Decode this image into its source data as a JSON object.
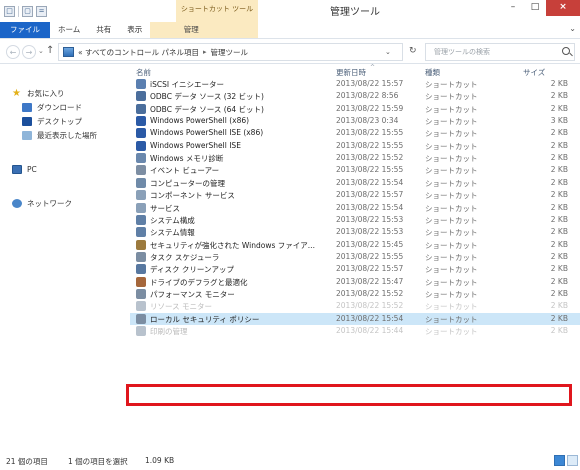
{
  "window": {
    "title": "管理ツール",
    "contextual_group": "ショートカット ツール"
  },
  "quick_access": [
    "□",
    "▢",
    "="
  ],
  "ribbon": {
    "tabs": [
      {
        "label": "ファイル",
        "kind": "file"
      },
      {
        "label": "ホーム",
        "kind": "normal"
      },
      {
        "label": "共有",
        "kind": "normal"
      },
      {
        "label": "表示",
        "kind": "normal"
      },
      {
        "label": "管理",
        "kind": "ctx"
      }
    ],
    "expand_glyph": "⌄"
  },
  "window_controls": {
    "minimize": "–",
    "maximize": "□",
    "close": "×"
  },
  "address_bar": {
    "back": "←",
    "forward": "→",
    "dropdown": "⌄",
    "up": "↑",
    "crumbs": [
      "« すべてのコントロール パネル項目",
      "管理ツール"
    ],
    "crumb_separator": "▸",
    "refresh": "↻",
    "search_placeholder": "管理ツールの検索"
  },
  "navigation": {
    "favorites": "お気に入り",
    "items": [
      "ダウンロード",
      "デスクトップ",
      "最近表示した場所"
    ],
    "pc": "PC",
    "network": "ネットワーク"
  },
  "columns": {
    "name": "名前",
    "date": "更新日時",
    "type": "種類",
    "size": "サイズ"
  },
  "files": [
    {
      "name": "iSCSI イニシエーター",
      "date": "2013/08/22 15:57",
      "type": "ショートカット",
      "size": "2 KB",
      "icon_color": "#5a7fb0"
    },
    {
      "name": "ODBC データ ソース (32 ビット)",
      "date": "2013/08/22 8:56",
      "type": "ショートカット",
      "size": "2 KB",
      "icon_color": "#4b6e9c"
    },
    {
      "name": "ODBC データ ソース (64 ビット)",
      "date": "2013/08/22 15:59",
      "type": "ショートカット",
      "size": "2 KB",
      "icon_color": "#4b6e9c"
    },
    {
      "name": "Windows PowerShell (x86)",
      "date": "2013/08/23 0:34",
      "type": "ショートカット",
      "size": "3 KB",
      "icon_color": "#2b5aa6"
    },
    {
      "name": "Windows PowerShell ISE (x86)",
      "date": "2013/08/22 15:55",
      "type": "ショートカット",
      "size": "2 KB",
      "icon_color": "#2b5aa6"
    },
    {
      "name": "Windows PowerShell ISE",
      "date": "2013/08/22 15:55",
      "type": "ショートカット",
      "size": "2 KB",
      "icon_color": "#2b5aa6"
    },
    {
      "name": "Windows メモリ診断",
      "date": "2013/08/22 15:52",
      "type": "ショートカット",
      "size": "2 KB",
      "icon_color": "#6a88ad"
    },
    {
      "name": "イベント ビューアー",
      "date": "2013/08/22 15:55",
      "type": "ショートカット",
      "size": "2 KB",
      "icon_color": "#7d8ea3"
    },
    {
      "name": "コンピューターの管理",
      "date": "2013/08/22 15:54",
      "type": "ショートカット",
      "size": "2 KB",
      "icon_color": "#6f8aa8"
    },
    {
      "name": "コンポーネント サービス",
      "date": "2013/08/22 15:57",
      "type": "ショートカット",
      "size": "2 KB",
      "icon_color": "#8aa0b8"
    },
    {
      "name": "サービス",
      "date": "2013/08/22 15:54",
      "type": "ショートカット",
      "size": "2 KB",
      "icon_color": "#8aa0b8"
    },
    {
      "name": "システム構成",
      "date": "2013/08/22 15:53",
      "type": "ショートカット",
      "size": "2 KB",
      "icon_color": "#5f7fa6"
    },
    {
      "name": "システム情報",
      "date": "2013/08/22 15:53",
      "type": "ショートカット",
      "size": "2 KB",
      "icon_color": "#5f7fa6"
    },
    {
      "name": "セキュリティが強化された Windows ファイア...",
      "date": "2013/08/22 15:45",
      "type": "ショートカット",
      "size": "2 KB",
      "icon_color": "#9c7a3e"
    },
    {
      "name": "タスク スケジューラ",
      "date": "2013/08/22 15:55",
      "type": "ショートカット",
      "size": "2 KB",
      "icon_color": "#7b8da2"
    },
    {
      "name": "ディスク クリーンアップ",
      "date": "2013/08/22 15:57",
      "type": "ショートカット",
      "size": "2 KB",
      "icon_color": "#5878a0"
    },
    {
      "name": "ドライブのデフラグと最適化",
      "date": "2013/08/22 15:47",
      "type": "ショートカット",
      "size": "2 KB",
      "icon_color": "#a5673b"
    },
    {
      "name": "パフォーマンス モニター",
      "date": "2013/08/22 15:52",
      "type": "ショートカット",
      "size": "2 KB",
      "icon_color": "#7b8da2"
    },
    {
      "name": "リソース モニター",
      "date": "2013/08/22 15:52",
      "type": "ショートカット",
      "size": "2 KB",
      "icon_color": "#b8c2cd",
      "faded": true
    },
    {
      "name": "ローカル セキュリティ ポリシー",
      "date": "2013/08/22 15:54",
      "type": "ショートカット",
      "size": "2 KB",
      "icon_color": "#7b8da2",
      "selected": true
    },
    {
      "name": "印刷の管理",
      "date": "2013/08/22 15:44",
      "type": "ショートカット",
      "size": "2 KB",
      "icon_color": "#b8c2cd",
      "faded": true
    }
  ],
  "status": {
    "count": "21 個の項目",
    "selected": "1 個の項目を選択",
    "size": "1.09 KB"
  },
  "highlight_color": "#e0161d"
}
